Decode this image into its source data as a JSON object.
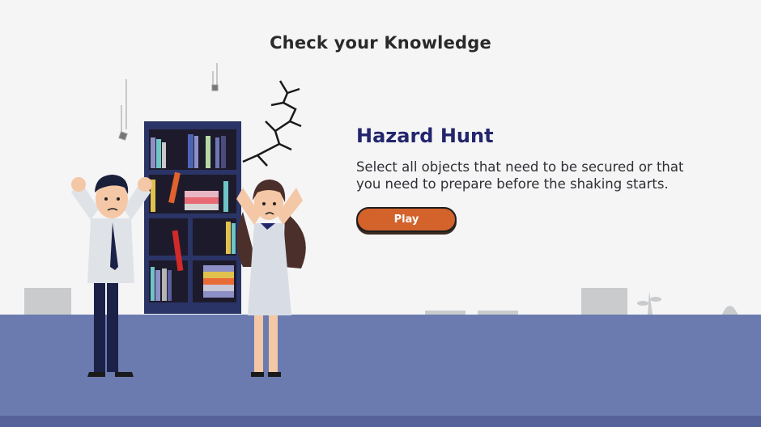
{
  "header": {
    "title": "Check your Knowledge"
  },
  "activity": {
    "title": "Hazard Hunt",
    "description": "Select all objects that need to be secured or that you need to prepare before the shaking starts.",
    "play_label": "Play"
  },
  "colors": {
    "background": "#f5f5f6",
    "floor": "#6b7bb0",
    "title": "#23266d",
    "play_button": "#d3622b",
    "bookshelf": "#2a3467"
  }
}
